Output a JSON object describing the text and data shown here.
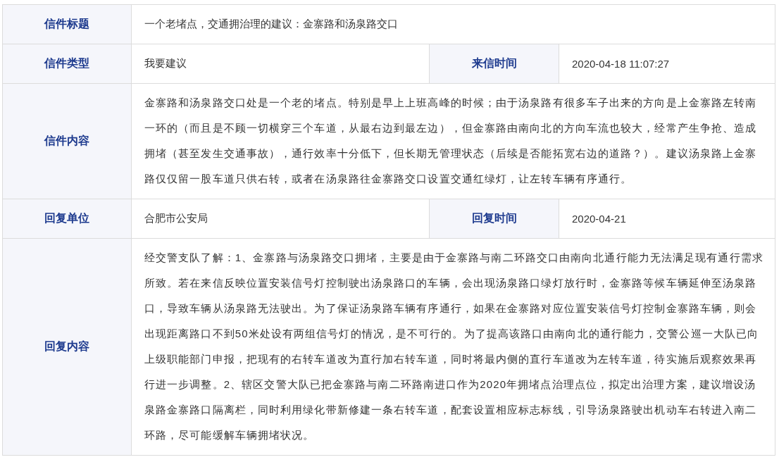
{
  "rows": [
    {
      "kind": "single",
      "label": "信件标题",
      "value": "一个老堵点，交通拥治理的建议：金寨路和汤泉路交口"
    },
    {
      "kind": "pair",
      "cells": [
        {
          "label": "信件类型",
          "value": "我要建议"
        },
        {
          "label": "来信时间",
          "value": "2020-04-18 11:07:27"
        }
      ]
    },
    {
      "kind": "paragraph",
      "label": "信件内容",
      "value": "金寨路和汤泉路交口处是一个老的堵点。特别是早上上班高峰的时候；由于汤泉路有很多车子出来的方向是上金寨路左转南一环的（而且是不顾一切横穿三个车道，从最右边到最左边），但金寨路由南向北的方向车流也较大，经常产生争抢、造成拥堵（甚至发生交通事故），通行效率十分低下，但长期无管理状态（后续是否能拓宽右边的道路？）。建议汤泉路上金寨路仅仅留一股车道只供右转，或者在汤泉路往金寨路交口设置交通红绿灯，让左转车辆有序通行。"
    },
    {
      "kind": "pair",
      "cells": [
        {
          "label": "回复单位",
          "value": "合肥市公安局"
        },
        {
          "label": "回复时间",
          "value": "2020-04-21"
        }
      ]
    },
    {
      "kind": "paragraph",
      "label": "回复内容",
      "value": "经交警支队了解：1、金寨路与汤泉路交口拥堵，主要是由于金寨路与南二环路交口由南向北通行能力无法满足现有通行需求所致。若在来信反映位置安装信号灯控制驶出汤泉路口的车辆，会出现汤泉路口绿灯放行时，金寨路等候车辆延伸至汤泉路口，导致车辆从汤泉路无法驶出。为了保证汤泉路车辆有序通行，如果在金寨路对应位置安装信号灯控制金寨路车辆，则会出现距离路口不到50米处设有两组信号灯的情况，是不可行的。为了提高该路口由南向北的通行能力，交警公巡一大队已向上级职能部门申报，把现有的右转车道改为直行加右转车道，同时将最内侧的直行车道改为左转车道，待实施后观察效果再行进一步调整。2、辖区交警大队已把金寨路与南二环路南进口作为2020年拥堵点治理点位，拟定出治理方案，建议增设汤泉路金寨路口隔离栏，同时利用绿化带新修建一条右转车道，配套设置相应标志标线，引导汤泉路驶出机动车右转进入南二环路，尽可能缓解车辆拥堵状况。"
    }
  ]
}
